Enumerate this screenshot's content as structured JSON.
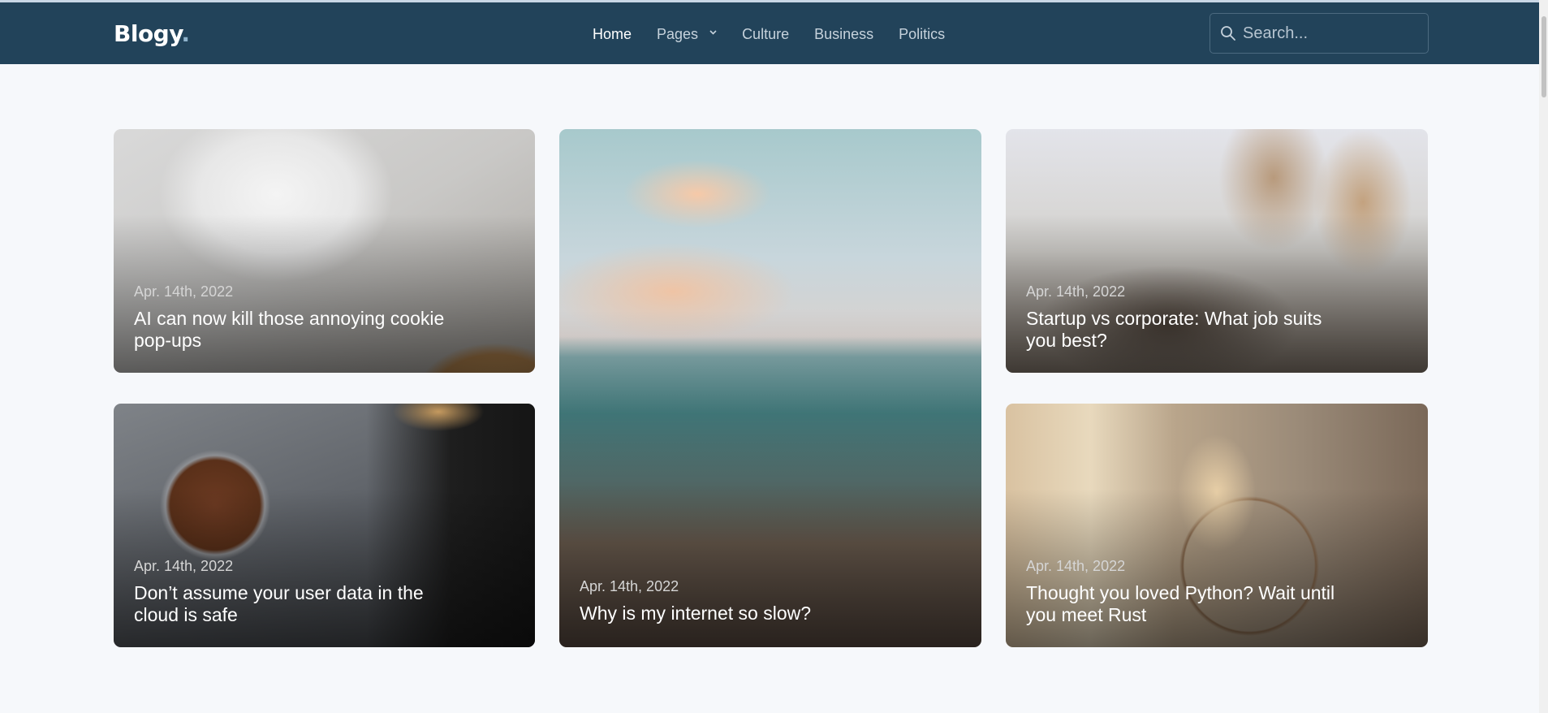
{
  "brand": {
    "name": "Blogy",
    "dot": "."
  },
  "nav": {
    "items": [
      {
        "label": "Home",
        "active": true
      },
      {
        "label": "Pages",
        "dropdown": true
      },
      {
        "label": "Culture"
      },
      {
        "label": "Business"
      },
      {
        "label": "Politics"
      }
    ]
  },
  "search": {
    "placeholder": "Search...",
    "value": "",
    "icon": "search-icon"
  },
  "posts": [
    {
      "date": "Apr. 14th, 2022",
      "title": "AI can now kill those annoying cookie pop-ups"
    },
    {
      "date": "Apr. 14th, 2022",
      "title": "Why is my internet so slow?"
    },
    {
      "date": "Apr. 14th, 2022",
      "title": "Startup vs corporate: What job suits you best?"
    },
    {
      "date": "Apr. 14th, 2022",
      "title": "Don’t assume your user data in the cloud is safe"
    },
    {
      "date": "Apr. 14th, 2022",
      "title": "Thought you loved Python? Wait until you meet Rust"
    }
  ],
  "colors": {
    "navbar": "#22435a",
    "page_background": "#f6f8fb",
    "nav_active": "#ffffff",
    "nav_text": "#c6d2dc"
  }
}
